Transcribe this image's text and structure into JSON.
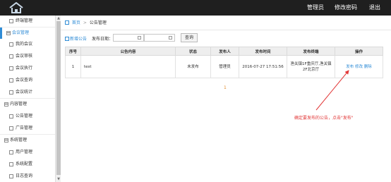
{
  "header": {
    "links": [
      "管理员",
      "修改密码",
      "退出"
    ]
  },
  "sidebar": {
    "items": [
      {
        "label": "终端管理",
        "type": "child"
      },
      {
        "label": "会议管理",
        "type": "group",
        "active": true
      },
      {
        "label": "我的会议",
        "type": "child"
      },
      {
        "label": "会议审核",
        "type": "child"
      },
      {
        "label": "会议执行",
        "type": "child"
      },
      {
        "label": "会议查询",
        "type": "child"
      },
      {
        "label": "会议统计",
        "type": "child"
      },
      {
        "label": "内容管理",
        "type": "group"
      },
      {
        "label": "公告管理",
        "type": "child"
      },
      {
        "label": "广告管理",
        "type": "child"
      },
      {
        "label": "系统管理",
        "type": "group"
      },
      {
        "label": "用户管理",
        "type": "child"
      },
      {
        "label": "系统配置",
        "type": "child"
      },
      {
        "label": "日志查询",
        "type": "child"
      }
    ]
  },
  "breadcrumb": {
    "home": "首页",
    "separator": ">",
    "current": "公告管理"
  },
  "toolbar": {
    "add_label": "新增公告",
    "date_label": "发布日期：",
    "date_from": "",
    "date_to": "",
    "dash": "-",
    "search_label": "查询"
  },
  "table": {
    "columns": [
      "序号",
      "公告内容",
      "状态",
      "发布人",
      "发布时间",
      "发布终端",
      "操作"
    ],
    "rows": [
      {
        "index": "1",
        "content": "test",
        "status": "未发布",
        "publisher": "管理员",
        "time": "2016-07-27 17:51:56",
        "terminal": "渔关镇1F重庆厅,渔关镇2F北京厅",
        "actions": [
          "发布",
          "修改",
          "删除"
        ]
      }
    ]
  },
  "pager_mark": "1",
  "annotation": "确定要发布的公告，点击\"发布\"",
  "colors": {
    "topbar": "#1f1f1f",
    "accent": "#2f8cd6",
    "annotation": "#e23838"
  }
}
